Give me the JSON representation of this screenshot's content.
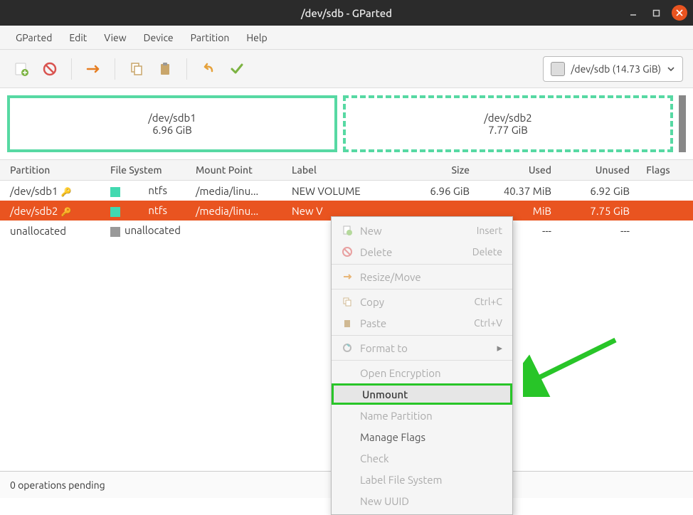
{
  "window": {
    "title": "/dev/sdb - GParted"
  },
  "menu": {
    "items": [
      "GParted",
      "Edit",
      "View",
      "Device",
      "Partition",
      "Help"
    ]
  },
  "device_selector": {
    "label": "/dev/sdb (14.73 GiB)"
  },
  "disk_map": [
    {
      "name": "/dev/sdb1",
      "size": "6.96 GiB",
      "selected": false
    },
    {
      "name": "/dev/sdb2",
      "size": "7.77 GiB",
      "selected": true
    }
  ],
  "table": {
    "headers": {
      "partition": "Partition",
      "fs": "File System",
      "mount": "Mount Point",
      "label": "Label",
      "size": "Size",
      "used": "Used",
      "unused": "Unused",
      "flags": "Flags"
    },
    "rows": [
      {
        "partition": "/dev/sdb1",
        "locked": true,
        "fs": "ntfs",
        "mount": "/media/linu...",
        "label": "NEW VOLUME",
        "size": "6.96 GiB",
        "used": "40.37 MiB",
        "unused": "6.92 GiB"
      },
      {
        "partition": "/dev/sdb2",
        "locked": true,
        "fs": "ntfs",
        "mount": "/media/linu...",
        "label": "New V",
        "size": "",
        "used": "MiB",
        "unused": "7.75 GiB",
        "selected": true
      },
      {
        "partition": "unallocated",
        "locked": false,
        "fs": "unallocated",
        "mount": "",
        "label": "",
        "size": "",
        "used": "---",
        "unused": "---",
        "unalloc": true
      }
    ]
  },
  "context_menu": {
    "items": [
      {
        "label": "New",
        "shortcut": "Insert",
        "icon": "new",
        "disabled": true
      },
      {
        "label": "Delete",
        "shortcut": "Delete",
        "icon": "delete",
        "disabled": true
      },
      {
        "sep": true
      },
      {
        "label": "Resize/Move",
        "icon": "resize",
        "disabled": true
      },
      {
        "sep": true
      },
      {
        "label": "Copy",
        "shortcut": "Ctrl+C",
        "icon": "copy",
        "disabled": true
      },
      {
        "label": "Paste",
        "shortcut": "Ctrl+V",
        "icon": "paste",
        "disabled": true
      },
      {
        "sep": true
      },
      {
        "label": "Format to",
        "icon": "format",
        "submenu": true,
        "disabled": true
      },
      {
        "sep": true
      },
      {
        "label": "Open Encryption",
        "disabled": true
      },
      {
        "label": "Unmount",
        "highlighted": true
      },
      {
        "label": "Name Partition",
        "disabled": true
      },
      {
        "label": "Manage Flags"
      },
      {
        "label": "Check",
        "disabled": true
      },
      {
        "label": "Label File System",
        "disabled": true
      },
      {
        "label": "New UUID",
        "disabled": true
      }
    ]
  },
  "status": {
    "text": "0 operations pending"
  }
}
